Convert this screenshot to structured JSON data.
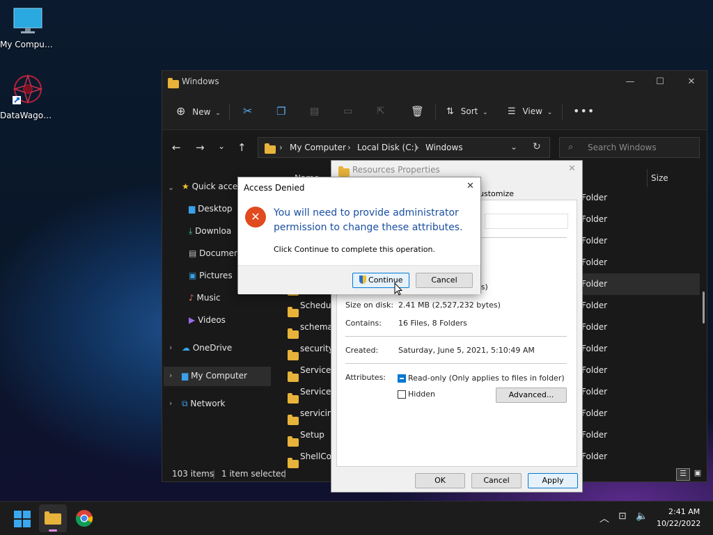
{
  "desktop": {
    "icons": [
      {
        "label": "My Computer"
      },
      {
        "label": "DataWagon..."
      }
    ]
  },
  "explorer": {
    "title": "Windows",
    "toolbar": {
      "new_label": "New",
      "sort_label": "Sort",
      "view_label": "View"
    },
    "address": {
      "parts": [
        "My Computer",
        "Local Disk (C:)",
        "Windows"
      ]
    },
    "search": {
      "placeholder": "Search Windows"
    },
    "nav": {
      "quick_access": "Quick acce",
      "desktop": "Desktop",
      "downloads": "Downloa",
      "documents": "Documen",
      "pictures": "Pictures",
      "music": "Music",
      "videos": "Videos",
      "onedrive": "OneDrive",
      "my_computer": "My Computer",
      "network": "Network"
    },
    "columns": {
      "name": "Name",
      "size": "Size"
    },
    "rows": [
      {
        "name": "",
        "type": "folder"
      },
      {
        "name": "",
        "type": "folder"
      },
      {
        "name": "",
        "type": "folder"
      },
      {
        "name": "",
        "type": "folder"
      },
      {
        "name": "",
        "type": "folder"
      },
      {
        "name": "Schedul",
        "type": "folder"
      },
      {
        "name": "schemas",
        "type": "folder"
      },
      {
        "name": "security",
        "type": "folder"
      },
      {
        "name": "ServiceP",
        "type": "folder"
      },
      {
        "name": "ServiceSt",
        "type": "folder"
      },
      {
        "name": "servicing",
        "type": "folder"
      },
      {
        "name": "Setup",
        "type": "folder"
      },
      {
        "name": "ShellCon",
        "type": "folder"
      }
    ],
    "type_text": "Folder",
    "status": {
      "items": "103 items",
      "selected": "1 item selected"
    }
  },
  "properties": {
    "title": "Resources Properties",
    "tab_customize": "ustomize",
    "size_fragment": "es)",
    "size_on_disk_label": "Size on disk:",
    "size_on_disk_value": "2.41 MB (2,527,232 bytes)",
    "contains_label": "Contains:",
    "contains_value": "16 Files, 8 Folders",
    "created_label": "Created:",
    "created_value": "Saturday, June 5, 2021, 5:10:49 AM",
    "attributes_label": "Attributes:",
    "readonly_label": "Read-only (Only applies to files in folder)",
    "hidden_label": "Hidden",
    "advanced_label": "Advanced...",
    "ok_label": "OK",
    "cancel_label": "Cancel",
    "apply_label": "Apply"
  },
  "access_denied": {
    "title": "Access Denied",
    "heading": "You will need to provide administrator permission to change these attributes.",
    "body": "Click Continue to complete this operation.",
    "continue_label": "Continue",
    "cancel_label": "Cancel"
  },
  "taskbar": {
    "time": "2:41 AM",
    "date": "10/22/2022"
  },
  "colors": {
    "accent": "#0078d4",
    "error": "#e04a1f",
    "heading_blue": "#1a4fa0"
  }
}
